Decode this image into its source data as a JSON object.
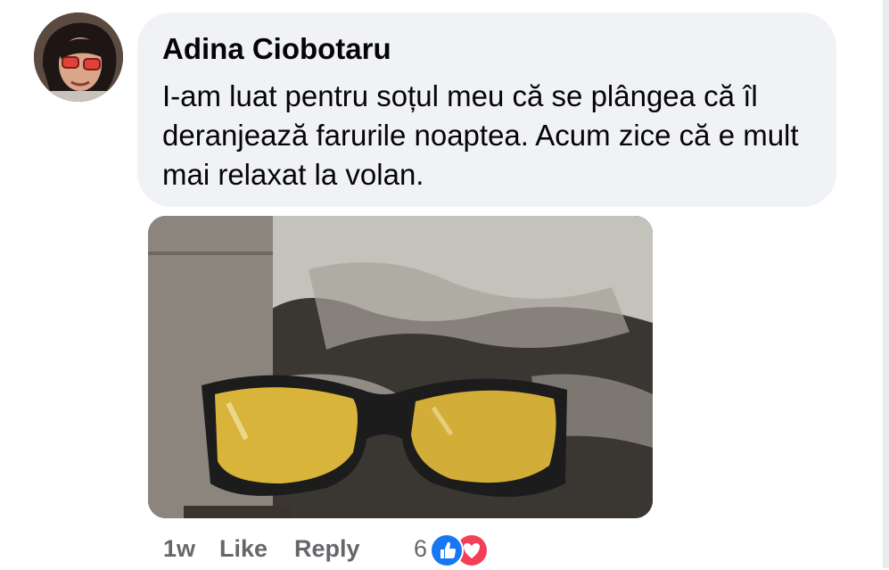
{
  "comment": {
    "author": "Adina Ciobotaru",
    "text": "I-am luat pentru soțul meu că se plângea că îl deranjează farurile noaptea. Acum zice că e mult mai relaxat la volan."
  },
  "actions": {
    "time": "1w",
    "like_label": "Like",
    "reply_label": "Reply"
  },
  "reactions": {
    "count": "6",
    "types": [
      "like-icon",
      "love-icon"
    ]
  },
  "colors": {
    "bubble": "#f0f2f5",
    "text": "#050505",
    "meta": "#65676b",
    "like": "#1877f2",
    "love": "#f33e58"
  }
}
